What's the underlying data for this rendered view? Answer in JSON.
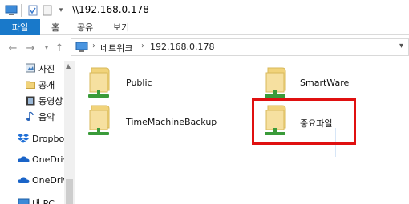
{
  "window": {
    "title": "\\\\192.168.0.178"
  },
  "ribbon": {
    "tabs": [
      {
        "label": "파일"
      },
      {
        "label": "홈"
      },
      {
        "label": "공유"
      },
      {
        "label": "보기"
      }
    ]
  },
  "address": {
    "segments": [
      "네트워크",
      "192.168.0.178"
    ]
  },
  "sidebar": {
    "items": [
      {
        "label": "사진",
        "icon": "pictures-icon"
      },
      {
        "label": "공개",
        "icon": "folder-icon"
      },
      {
        "label": "동영상",
        "icon": "videos-icon"
      },
      {
        "label": "음악",
        "icon": "music-icon"
      },
      {
        "label": "Dropbox",
        "icon": "dropbox-icon"
      },
      {
        "label": "OneDrive",
        "icon": "onedrive-icon"
      },
      {
        "label": "OneDrive",
        "icon": "onedrive-icon"
      },
      {
        "label": "내 PC",
        "icon": "pc-icon"
      }
    ]
  },
  "content": {
    "shares": [
      {
        "label": "Public",
        "icon": "network-share-folder-icon"
      },
      {
        "label": "SmartWare",
        "icon": "network-share-folder-icon"
      },
      {
        "label": "TimeMachineBackup",
        "icon": "network-share-folder-icon"
      },
      {
        "label": "중요파일",
        "icon": "network-share-folder-icon",
        "highlighted": true
      }
    ],
    "highlight_color": "#e01010"
  },
  "colors": {
    "file_tab": "#1979ca",
    "folder": "#f1d37a",
    "network_green": "#3a9b3a"
  }
}
